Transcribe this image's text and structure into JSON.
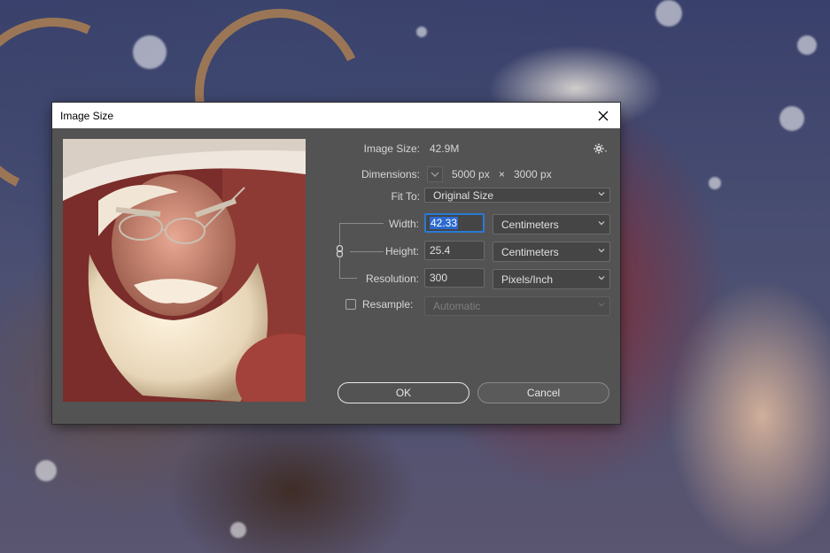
{
  "dialog": {
    "title": "Image Size",
    "image_size_label": "Image Size:",
    "image_size_value": "42.9M",
    "dimensions_label": "Dimensions:",
    "dimensions_width": "5000 px",
    "dimensions_times": "×",
    "dimensions_height": "3000 px",
    "fit_to_label": "Fit To:",
    "fit_to_value": "Original Size",
    "width_label": "Width:",
    "width_value": "42.33",
    "width_unit": "Centimeters",
    "height_label": "Height:",
    "height_value": "25.4",
    "height_unit": "Centimeters",
    "resolution_label": "Resolution:",
    "resolution_value": "300",
    "resolution_unit": "Pixels/Inch",
    "resample_label": "Resample:",
    "resample_checked": false,
    "resample_value": "Automatic",
    "ok_label": "OK",
    "cancel_label": "Cancel"
  },
  "icons": {
    "close": "close-icon",
    "settings": "gear-icon",
    "link": "chain-link-icon",
    "dimensions_dropdown": "chevron-down-icon"
  },
  "colors": {
    "dialog_bg": "#535353",
    "titlebar_bg": "#ffffff",
    "focus_blue": "#2a7ad6",
    "selection_blue": "#2c6ad0"
  }
}
